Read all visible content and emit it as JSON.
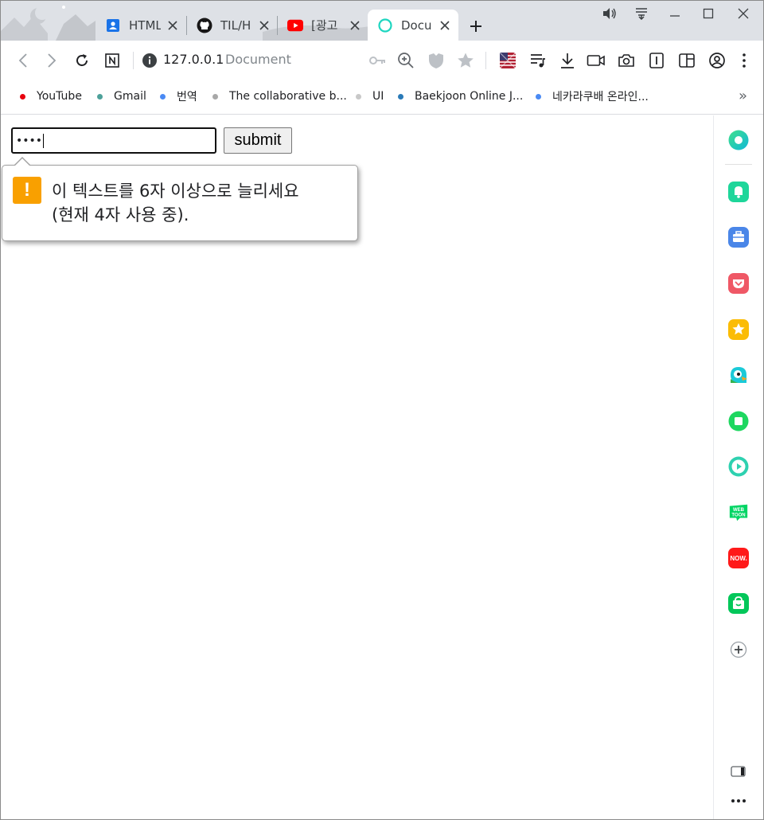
{
  "tabs": [
    {
      "title": "HTML",
      "icon": "contacts-icon",
      "active": false
    },
    {
      "title": "TIL/H",
      "icon": "github-icon",
      "active": false
    },
    {
      "title": "[광고",
      "icon": "youtube-icon",
      "active": false
    },
    {
      "title": "Docu",
      "icon": "loading-ring-icon",
      "active": true
    }
  ],
  "toolbar": {
    "url_host": "127.0.0.1",
    "url_title": "Document"
  },
  "bookmarks": [
    {
      "label": "YouTube",
      "dot_color": "#e8000e"
    },
    {
      "label": "Gmail",
      "dot_color": "#4da19a"
    },
    {
      "label": "번역",
      "dot_color": "#4a8af4"
    },
    {
      "label": "The collaborative b...",
      "dot_color": "#a8a8a8"
    },
    {
      "label": "UI",
      "dot_color": "#c8c8c8"
    },
    {
      "label": "Baekjoon Online J...",
      "dot_color": "#2a7ab8"
    },
    {
      "label": "네카라쿠배 온라인...",
      "dot_color": "#4a8af4"
    }
  ],
  "form": {
    "password_mask": "••••",
    "submit_label": "submit"
  },
  "validation": {
    "line1": "이 텍스트를 6자 이상으로 늘리세요",
    "line2": "(현재 4자 사용 중).",
    "warn_glyph": "!"
  },
  "sidebar_icons": [
    "whale-icon",
    "alarm-bell-icon",
    "briefcase-icon",
    "pocket-icon",
    "star-badge-icon",
    "papago-icon",
    "square-app-icon",
    "play-circle-icon",
    "webtoon-icon",
    "now-icon",
    "shopping-bag-icon",
    "add-icon",
    "toggle-panel-icon",
    "more-icon"
  ],
  "sidebar_labels": {
    "webtoon": "WEB TOON",
    "now": "NOW."
  },
  "colors": {
    "warning": "#f9a000",
    "whale_green": "#1ed6a0",
    "tab_strip": "#dee1e6"
  }
}
